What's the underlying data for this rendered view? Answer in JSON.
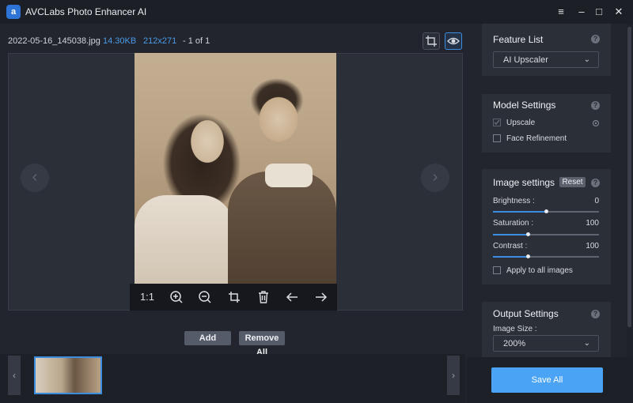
{
  "app": {
    "title": "AVCLabs Photo Enhancer AI",
    "logo_glyph": "a",
    "accent": "#3c8de0"
  },
  "window_controls": {
    "menu": "≡",
    "minimize": "–",
    "maximize": "□",
    "close": "✕"
  },
  "file_info": {
    "name": "2022-05-16_145038.jpg",
    "size": "14.30KB",
    "dimensions": "212x271",
    "count": "- 1 of 1"
  },
  "toolbar": {
    "ratio": "1:1"
  },
  "buttons": {
    "add": "Add",
    "remove_all": "Remove All",
    "save_all": "Save All"
  },
  "feature_list": {
    "title": "Feature List",
    "selected": "AI Upscaler"
  },
  "model_settings": {
    "title": "Model Settings",
    "upscale": {
      "label": "Upscale",
      "checked": true
    },
    "face_refinement": {
      "label": "Face Refinement",
      "checked": false
    }
  },
  "image_settings": {
    "title": "Image settings",
    "reset": "Reset",
    "brightness": {
      "label": "Brightness :",
      "value": "0",
      "fraction": 0.5
    },
    "saturation": {
      "label": "Saturation :",
      "value": "100",
      "fraction": 0.33
    },
    "contrast": {
      "label": "Contrast :",
      "value": "100",
      "fraction": 0.33
    },
    "apply_all": {
      "label": "Apply to all images",
      "checked": false
    }
  },
  "output_settings": {
    "title": "Output Settings",
    "image_size_label": "Image Size :",
    "image_size": "200%"
  },
  "help_glyph": "?",
  "glyphs": {
    "prev": "‹",
    "next": "›",
    "chevron": "⌄"
  }
}
